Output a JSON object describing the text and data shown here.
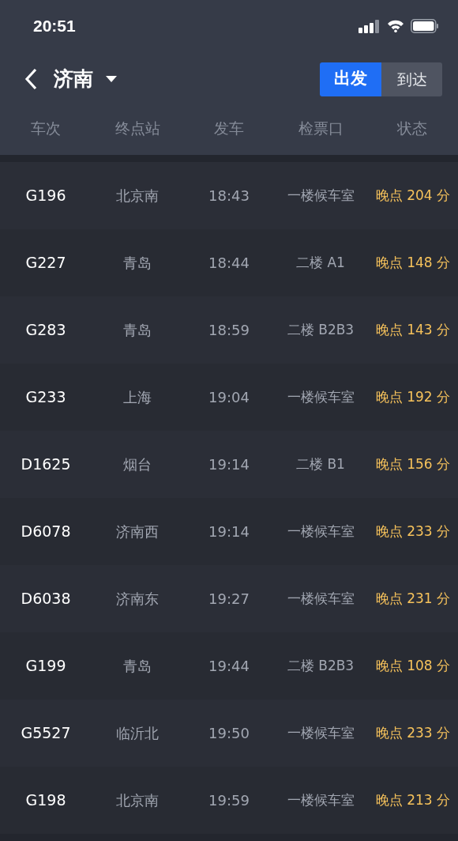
{
  "status_bar": {
    "time": "20:51"
  },
  "header": {
    "city": "济南",
    "tabs": [
      {
        "label": "出发",
        "selected": true
      },
      {
        "label": "到达",
        "selected": false
      }
    ]
  },
  "table": {
    "columns": [
      "车次",
      "终点站",
      "发车",
      "检票口",
      "状态"
    ],
    "rows": [
      {
        "train": "G196",
        "destination": "北京南",
        "departure": "18:43",
        "gate": "一楼候车室",
        "status": "晚点 204 分"
      },
      {
        "train": "G227",
        "destination": "青岛",
        "departure": "18:44",
        "gate": "二楼 A1",
        "status": "晚点 148 分"
      },
      {
        "train": "G283",
        "destination": "青岛",
        "departure": "18:59",
        "gate": "二楼 B2B3",
        "status": "晚点 143 分"
      },
      {
        "train": "G233",
        "destination": "上海",
        "departure": "19:04",
        "gate": "一楼候车室",
        "status": "晚点 192 分"
      },
      {
        "train": "D1625",
        "destination": "烟台",
        "departure": "19:14",
        "gate": "二楼 B1",
        "status": "晚点 156 分"
      },
      {
        "train": "D6078",
        "destination": "济南西",
        "departure": "19:14",
        "gate": "一楼候车室",
        "status": "晚点 233 分"
      },
      {
        "train": "D6038",
        "destination": "济南东",
        "departure": "19:27",
        "gate": "一楼候车室",
        "status": "晚点 231 分"
      },
      {
        "train": "G199",
        "destination": "青岛",
        "departure": "19:44",
        "gate": "二楼 B2B3",
        "status": "晚点 108 分"
      },
      {
        "train": "G5527",
        "destination": "临沂北",
        "departure": "19:50",
        "gate": "一楼候车室",
        "status": "晚点 233 分"
      },
      {
        "train": "G198",
        "destination": "北京南",
        "departure": "19:59",
        "gate": "一楼候车室",
        "status": "晚点 213 分"
      }
    ]
  }
}
